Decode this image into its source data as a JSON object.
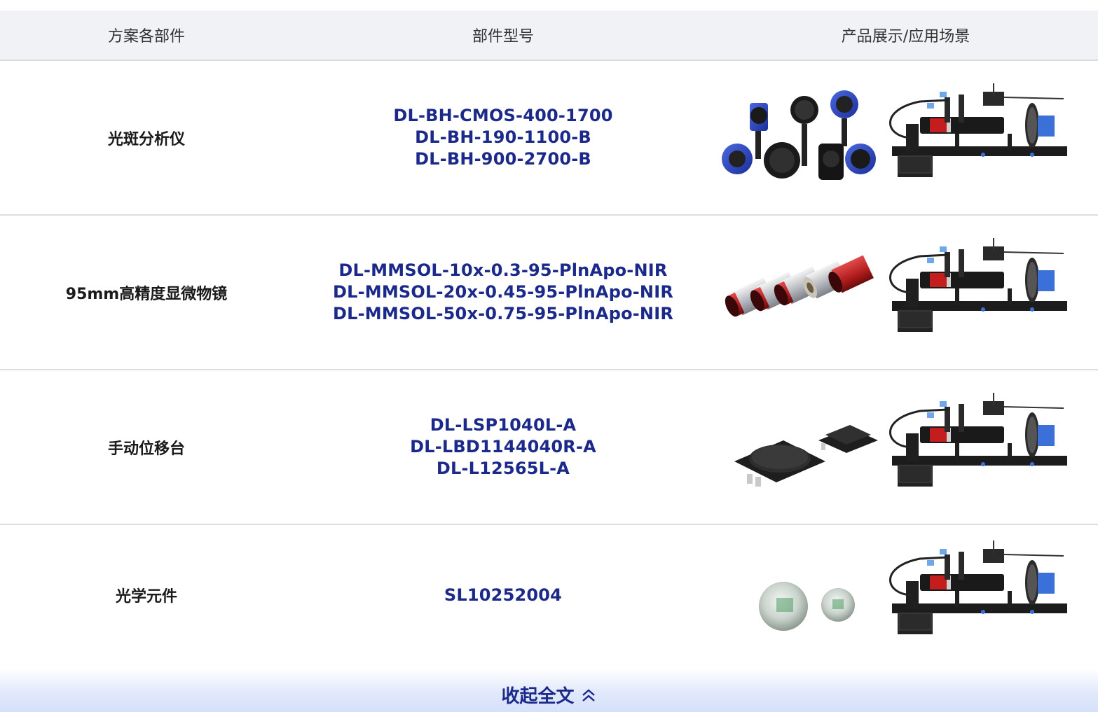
{
  "header": {
    "col1": "方案各部件",
    "col2": "部件型号",
    "col3": "产品展示/应用场景"
  },
  "rows": [
    {
      "name": "光斑分析仪",
      "models": [
        "DL-BH-CMOS-400-1700",
        "DL-BH-190-1100-B",
        "DL-BH-900-2700-B"
      ],
      "product_icon": "beam-profiler-set-icon"
    },
    {
      "name": "95mm高精度显微物镜",
      "models": [
        "DL-MMSOL-10x-0.3-95-PlnApo-NIR",
        "DL-MMSOL-20x-0.45-95-PlnApo-NIR",
        "DL-MMSOL-50x-0.75-95-PlnApo-NIR"
      ],
      "product_icon": "microscope-objectives-icon"
    },
    {
      "name": "手动位移台",
      "models": [
        "DL-LSP1040L-A",
        "DL-LBD1144040R-A",
        "DL-L12565L-A"
      ],
      "product_icon": "manual-stage-icon"
    },
    {
      "name": "光学元件",
      "models": [
        "SL10252004"
      ],
      "product_icon": "optical-element-icon"
    }
  ],
  "scene_icon": "optical-bench-setup-icon",
  "collapse": {
    "label": "收起全文",
    "icon": "double-chevron-up-icon"
  },
  "colors": {
    "accent": "#1b2a8a",
    "header_bg": "#f1f2f6",
    "divider": "#dcdde1"
  }
}
